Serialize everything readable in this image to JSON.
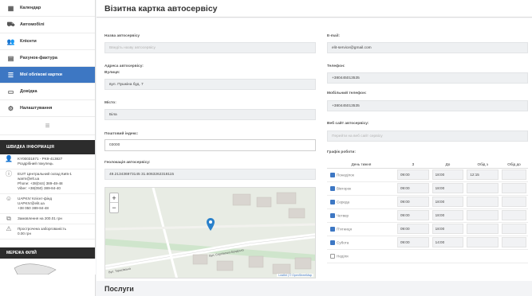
{
  "sidebar": {
    "items": [
      {
        "label": "Календар",
        "icon": "calendar-icon"
      },
      {
        "label": "Автомобілі",
        "icon": "car-icon"
      },
      {
        "label": "Клієнти",
        "icon": "users-icon"
      },
      {
        "label": "Рахунок-фактура",
        "icon": "invoice-icon"
      },
      {
        "label": "Мої облікові картки",
        "icon": "list-icon"
      },
      {
        "label": "Довідка",
        "icon": "book-icon"
      },
      {
        "label": "Налаштування",
        "icon": "gear-icon"
      }
    ],
    "active_index": 4,
    "info_header": "ШВИДКА ІНФОРМАЦІЯ",
    "info_items": [
      {
        "line1": "KY00031871 - PK9-413827",
        "line2": "Роздрібний покупець",
        "line3": "",
        "line4": ""
      },
      {
        "line1": "EUIT Центральний склад Київ-1",
        "line2": "warm@elt.ua",
        "line3": "Phone: +38(044) 389-48-48",
        "line4": "Viber: +38(050) 389-84-40"
      },
      {
        "line1": "UAPKIV Клієнт-фінд",
        "line2": "UAPKIV@elit.ua",
        "line3": "+38 050 389-84-48",
        "line4": ""
      },
      {
        "line1": "Замовлення на 200.01 грн",
        "line2": "",
        "line3": "",
        "line4": ""
      },
      {
        "line1": "Прострочена заборгованість",
        "line2": "0.00 грн",
        "line3": "",
        "line4": ""
      }
    ],
    "map_header": "МЕРЕЖА ФІЛІЙ"
  },
  "page": {
    "title": "Візитна картка автосервісу",
    "services_heading": "Послуги"
  },
  "form": {
    "name_label": "Назва автосервісу",
    "name_placeholder": "Введіть назву автосервісу",
    "address_label": "Адреса автосервісу:",
    "street_label": "Вулиця:",
    "street_value": "вул. Пушкіна буд. 7",
    "city_label": "Місто:",
    "city_value": "Біла",
    "postal_label": "Поштовий індекс:",
    "postal_value": "03000",
    "geo_label": "Геолокація автосервісу:",
    "geo_value": "49.213436973145 31.6063262318115",
    "email_label": "E-mail:",
    "email_value": "elit-service@gmail.com",
    "phone_label": "Телефон:",
    "phone_value": "+380445013535",
    "mobile_label": "Мобільний телефон:",
    "mobile_value": "+380445013535",
    "website_label": "Веб сайт автосервісу:",
    "website_placeholder": "Перейти на веб сайт сервісу",
    "schedule_label": "Графік роботи:"
  },
  "schedule": {
    "headers": [
      "День тижня",
      "З",
      "До",
      "Обід з",
      "Обід до"
    ],
    "rows": [
      {
        "day": "Понеділок",
        "checked": true,
        "from": "09:00",
        "to": "18:00",
        "lunch_from": "12:15",
        "lunch_to": ""
      },
      {
        "day": "Вівторок",
        "checked": true,
        "from": "09:00",
        "to": "18:00",
        "lunch_from": "",
        "lunch_to": ""
      },
      {
        "day": "Середа",
        "checked": true,
        "from": "09:00",
        "to": "18:00",
        "lunch_from": "",
        "lunch_to": ""
      },
      {
        "day": "Четвер",
        "checked": true,
        "from": "09:00",
        "to": "18:00",
        "lunch_from": "",
        "lunch_to": ""
      },
      {
        "day": "П'ятниця",
        "checked": true,
        "from": "09:00",
        "to": "18:00",
        "lunch_from": "",
        "lunch_to": ""
      },
      {
        "day": "Субота",
        "checked": true,
        "from": "09:00",
        "to": "14:00",
        "lunch_from": "",
        "lunch_to": ""
      },
      {
        "day": "Неділя",
        "checked": false,
        "from": "",
        "to": "",
        "lunch_from": "",
        "lunch_to": ""
      }
    ]
  },
  "map": {
    "zoom_in": "+",
    "zoom_out": "−",
    "street_label": "Вул. Сергіївсько-Бродська",
    "street_label_2": "Вул. Тарасівська",
    "attribution": "Leaflet | © OpenStreetMap",
    "marker_color": "#2a81cb"
  },
  "colors": {
    "accent": "#3d77c3",
    "dark_header": "#2c2c2c"
  }
}
